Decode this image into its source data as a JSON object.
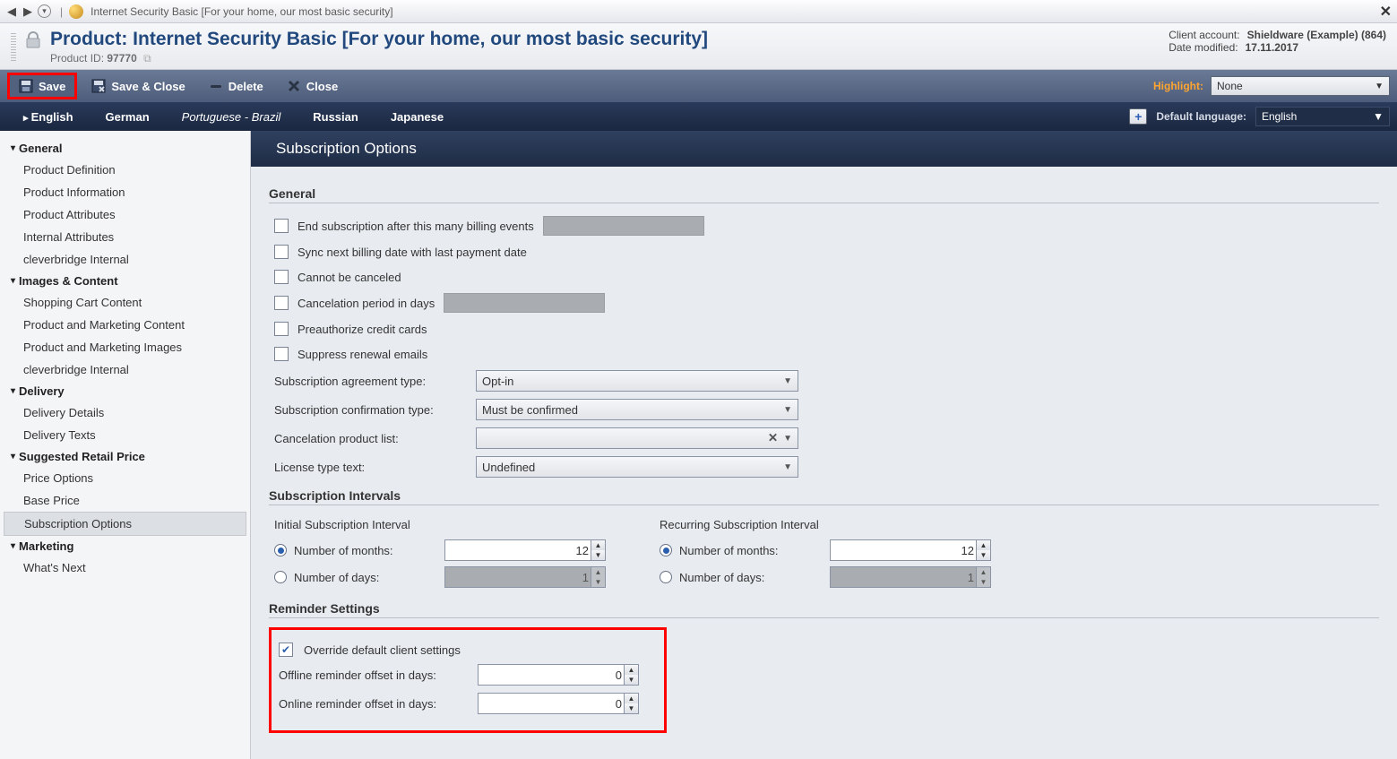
{
  "titlebar": {
    "text": "Internet Security Basic [For your home, our most basic security]"
  },
  "header": {
    "title": "Product: Internet Security Basic [For your home, our most basic security]",
    "product_id_label": "Product ID:",
    "product_id_value": "97770",
    "client_account_label": "Client account:",
    "client_account_value": "Shieldware (Example) (864)",
    "date_modified_label": "Date modified:",
    "date_modified_value": "17.11.2017"
  },
  "toolbar": {
    "save": "Save",
    "save_close": "Save & Close",
    "delete": "Delete",
    "close": "Close",
    "highlight_label": "Highlight:",
    "highlight_value": "None"
  },
  "langbar": {
    "tabs": [
      "English",
      "German",
      "Portuguese - Brazil",
      "Russian",
      "Japanese"
    ],
    "default_label": "Default language:",
    "default_value": "English"
  },
  "sidebar": {
    "g_general": "General",
    "i_prod_def": "Product Definition",
    "i_prod_info": "Product Information",
    "i_prod_attr": "Product Attributes",
    "i_int_attr": "Internal Attributes",
    "i_cb_internal1": "cleverbridge Internal",
    "g_images": "Images & Content",
    "i_cart": "Shopping Cart Content",
    "i_pm_content": "Product and Marketing Content",
    "i_pm_images": "Product and Marketing Images",
    "i_cb_internal2": "cleverbridge Internal",
    "g_delivery": "Delivery",
    "i_del_details": "Delivery Details",
    "i_del_texts": "Delivery Texts",
    "g_srp": "Suggested Retail Price",
    "i_price_opts": "Price Options",
    "i_base_price": "Base Price",
    "i_sub_opts": "Subscription Options",
    "g_marketing": "Marketing",
    "i_whats_next": "What's Next"
  },
  "main": {
    "section_title": "Subscription Options",
    "group_general": "General",
    "end_sub_label": "End subscription after this many billing events",
    "sync_label": "Sync next billing date with last payment date",
    "cannot_cancel_label": "Cannot be canceled",
    "cancel_period_label": "Cancelation period in days",
    "preauth_label": "Preauthorize credit cards",
    "suppress_label": "Suppress renewal emails",
    "agree_type_label": "Subscription agreement type:",
    "agree_type_value": "Opt-in",
    "confirm_type_label": "Subscription confirmation type:",
    "confirm_type_value": "Must be confirmed",
    "cancel_prod_label": "Cancelation product list:",
    "cancel_prod_value": "",
    "license_label": "License type text:",
    "license_value": "Undefined",
    "group_intervals": "Subscription Intervals",
    "initial_title": "Initial Subscription Interval",
    "recurring_title": "Recurring Subscription Interval",
    "months_label": "Number of months:",
    "days_label": "Number of days:",
    "initial_months": "12",
    "initial_days": "1",
    "recurring_months": "12",
    "recurring_days": "1",
    "group_reminder": "Reminder Settings",
    "override_label": "Override default client settings",
    "offline_label": "Offline reminder offset in days:",
    "offline_value": "0",
    "online_label": "Online reminder offset in days:",
    "online_value": "0"
  }
}
